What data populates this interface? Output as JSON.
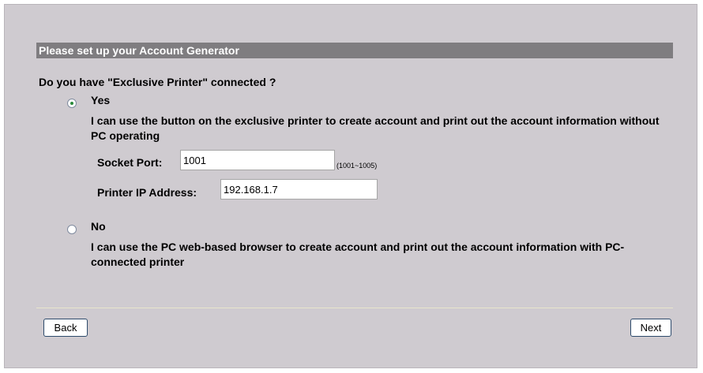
{
  "header": {
    "title": "Please set up your Account Generator"
  },
  "question": {
    "text": "Do you have \"Exclusive Printer\" connected ?"
  },
  "options": {
    "selected": "yes",
    "yes": {
      "label": "Yes",
      "description": "I can use the button on the exclusive printer to create account and print out the account information without PC operating"
    },
    "no": {
      "label": "No",
      "description": "I can use the PC web-based browser to create account and print out the account information with PC-connected printer"
    }
  },
  "fields": {
    "socket_port": {
      "label": "Socket Port:",
      "value": "1001",
      "hint": "(1001~1005)"
    },
    "printer_ip": {
      "label": "Printer IP Address:",
      "value": "192.168.1.7"
    }
  },
  "buttons": {
    "back_label": "Back",
    "next_label": "Next"
  },
  "colors": {
    "panel_background": "#cfcbd0",
    "header_background": "#7f7d80",
    "header_text": "#ffffff",
    "radio_dot": "#2a8a3a",
    "button_border": "#2d4a6b"
  }
}
